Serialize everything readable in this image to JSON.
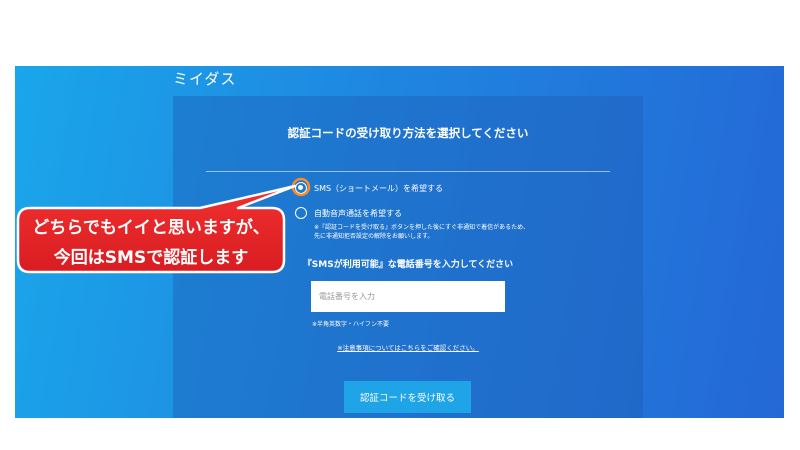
{
  "logo": {
    "text": "ミイダス"
  },
  "card": {
    "title": "認証コードの受け取り方法を選択してください",
    "options": [
      {
        "label": "SMS（ショートメール）を希望する",
        "selected": true
      },
      {
        "label": "自動音声通話を希望する",
        "selected": false
      }
    ],
    "voice_note": "※『認証コードを受け取る』ボタンを押した後にすぐ非通知で着信があるため、先に非通知拒否設定の解除をお願いします。",
    "phone_heading": "『SMSが利用可能』な電話番号を入力してください",
    "phone_input": {
      "placeholder": "電話番号を入力",
      "value": ""
    },
    "phone_hint": "※半角英数字・ハイフン不要",
    "notice_link": "※注意事項についてはこちらをご確認ください。",
    "submit_label": "認証コードを受け取る"
  },
  "annotation": {
    "line1": "どちらでもイイと思いますが、",
    "line2": "今回はSMSで認証します"
  },
  "colors": {
    "background_start": "#1aa6ea",
    "background_end": "#2468d6",
    "button": "#1fa4e8",
    "callout_fill": "#e8262b",
    "callout_highlight": "#ff8a1f"
  }
}
